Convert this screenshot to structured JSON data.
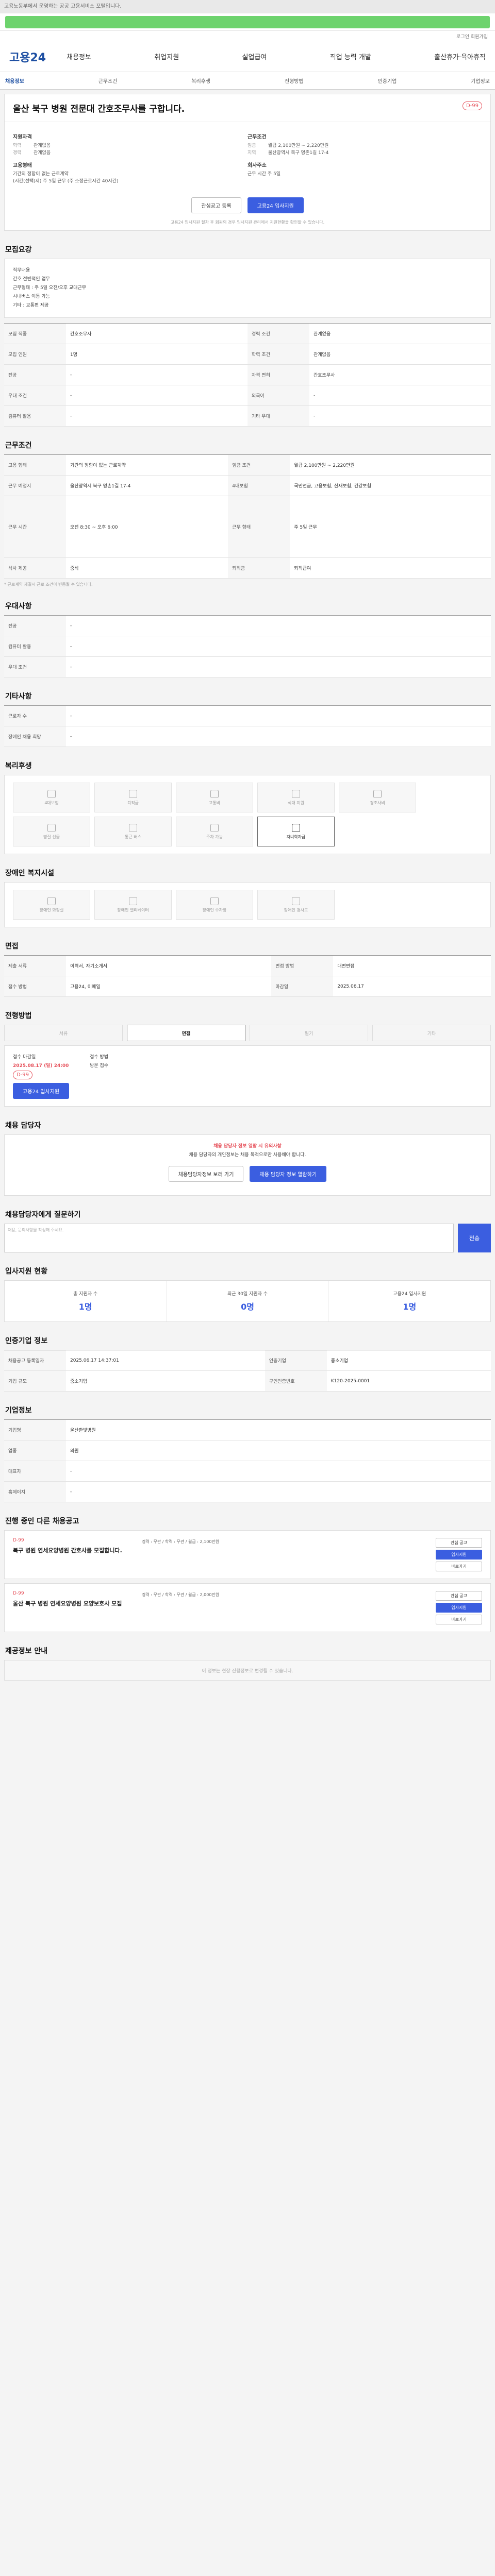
{
  "notice": "고용노동부에서 운영하는 공공 고용서비스 포털입니다.",
  "util": "로그인 회원가입",
  "logo": "고용24",
  "gnb": [
    "채용정보",
    "취업지원",
    "실업급여",
    "직업 능력 개발",
    "출산휴가·육아휴직"
  ],
  "tabs": [
    "채용정보",
    "근무조건",
    "복리후생",
    "전형방법",
    "인증기업",
    "기업정보"
  ],
  "job": {
    "title": "울산 북구 병원 전문대 간호조무사를 구합니다.",
    "dday": "D-99",
    "company_h": "지원자격",
    "edu_label": "학력",
    "edu": "관계없음",
    "career_label": "경력",
    "career": "관계없음",
    "cond_h": "근무조건",
    "pay_label": "임금",
    "pay": "월급 2,100만원 ~ 2,220만원",
    "loc_label": "지역",
    "loc": "울산광역시 북구 명촌1길 17-4",
    "type_h": "고용형태",
    "type": "기간의 정함이 없는 근로계약",
    "type2": "(시간(선택)제) 주 5일 근무 (주 소정근로시간 40시간)",
    "time_h": "회사주소",
    "time": "근무 시간 주 5일"
  },
  "buttons": {
    "scrap": "관심공고 등록",
    "apply": "고용24 입사지원"
  },
  "guide": "고용24 입사지원 절차 후 회원의 경우 입사지원 관리에서 지원현황을 확인할 수 있습니다.",
  "desc": {
    "title": "모집요강",
    "lines": [
      "직무내용",
      "간호 전반적인 업무",
      "근무형태 : 주 5일 오전/오후 교대근무",
      "시내버스 이동 가능",
      "기타 : 교통편 제공"
    ]
  },
  "reqrows": [
    [
      "모집 직종",
      "간호조무사",
      "경력 조건",
      "관계없음"
    ],
    [
      "모집 인원",
      "1명",
      "학력 조건",
      "관계없음"
    ],
    [
      "전공",
      "-",
      "자격 면허",
      "간호조무사"
    ],
    [
      "우대 조건",
      "-",
      "외국어",
      "-"
    ],
    [
      "컴퓨터 활용",
      "-",
      "기타 우대",
      "-"
    ]
  ],
  "workcond": {
    "title": "근무조건",
    "rows": [
      [
        "고용 형태",
        "기간의 정함이 없는 근로계약",
        "임금 조건",
        "월급 2,100만원 ~ 2,220만원"
      ],
      [
        "근무 예정지",
        "울산광역시 북구 명촌1길 17-4",
        "4대보험",
        "국민연금, 고용보험, 산재보험, 건강보험"
      ],
      [
        "근무 시간",
        "오전 8:30 ~ 오후 6:00",
        "근무 형태",
        "주 5일 근무"
      ],
      [
        "식사 제공",
        "중식",
        "퇴직금",
        "퇴직급여"
      ]
    ],
    "note": "* 근로계약 체결시 근로 조건이 변동될 수 있습니다."
  },
  "prefer": {
    "title": "우대사항",
    "rows": [
      [
        "전공",
        "-"
      ],
      [
        "컴퓨터 활용",
        "-"
      ],
      [
        "우대 조건",
        "-"
      ]
    ]
  },
  "etc": {
    "title": "기타사항",
    "rows": [
      [
        "근로자 수",
        "-"
      ],
      [
        "장애인 채용 희망",
        "-"
      ]
    ]
  },
  "benefits": {
    "title": "복리후생",
    "items": [
      "4대보험",
      "퇴직금",
      "교통비",
      "식대 지원",
      "경조사비",
      "명절 선물",
      "통근 버스",
      "주차 가능",
      "자녀학자금",
      "기숙사 제공"
    ],
    "on_index": 9
  },
  "disabled": {
    "title": "장애인 복지시설",
    "items": [
      "장애인 화장실",
      "장애인 엘리베이터",
      "장애인 주차장",
      "장애인 경사로"
    ]
  },
  "interview": {
    "title": "면접",
    "rows": [
      [
        "제출 서류",
        "이력서, 자기소개서",
        "면접 방법",
        "대면면접"
      ],
      [
        "접수 방법",
        "고용24, 이메일",
        "마감일",
        "2025.06.17"
      ]
    ]
  },
  "apply": {
    "title": "전형방법",
    "tabs": [
      "서류",
      "면접",
      "필기",
      "기타"
    ],
    "on": 1,
    "left_label": "접수 마감일",
    "left": "2025.08.17 (일) 24:00",
    "right_label": "접수 방법",
    "right": "방문 접수",
    "d": "D-99"
  },
  "contact": {
    "title": "채용 담당자",
    "head": "채용 담당자 정보 열람 시 유의사항",
    "body": "채용 담당자의 개인정보는 채용 목적으로만 사용해야 합니다.",
    "btn1": "채용담당자정보 보러 가기",
    "btn2": "채용 담당자 정보 열람하기"
  },
  "qna": {
    "title": "채용담당자에게 질문하기",
    "placeholder": "채용, 문의사항을 작성해 주세요.",
    "send": "전송"
  },
  "stats": {
    "title": "입사지원 현황",
    "items": [
      [
        "총 지원자 수",
        "1명"
      ],
      [
        "최근 30일 지원자 수",
        "0명"
      ],
      [
        "고용24 입사지원",
        "1명"
      ]
    ]
  },
  "cert": {
    "title": "인증기업 정보",
    "rows": [
      [
        "채용공고 등록일자",
        "2025.06.17 14:37:01",
        "인증기업",
        "중소기업"
      ],
      [
        "기업 규모",
        "중소기업",
        "구인인증번호",
        "K120-2025-0001"
      ]
    ]
  },
  "company": {
    "title": "기업정보",
    "rows": [
      [
        "기업명",
        "울산한빛병원"
      ],
      [
        "업종",
        "의원"
      ],
      [
        "대표자",
        "-"
      ],
      [
        "홈페이지",
        "-"
      ]
    ]
  },
  "related": {
    "title": "진행 중인 다른 채용공고",
    "items": [
      {
        "d": "D-99",
        "t": "북구 병원 연세요양병원 간호사를 모집합니다.",
        "m": "경력 : 무관 / 학력 : 무관 / 월급 : 2,100만원",
        "btns": [
          "관심 공고",
          "입사지원",
          "바로가기"
        ]
      },
      {
        "d": "D-99",
        "t": "울산 북구 병원 연세요양병원 요양보호사 모집",
        "m": "경력 : 무관 / 학력 : 무관 / 월급 : 2,000만원",
        "btns": [
          "관심 공고",
          "입사지원",
          "바로가기"
        ]
      }
    ]
  },
  "footer": {
    "title": "제공정보 안내",
    "text": "이 정보는 현장 진행정보로 변경될 수 있습니다."
  }
}
